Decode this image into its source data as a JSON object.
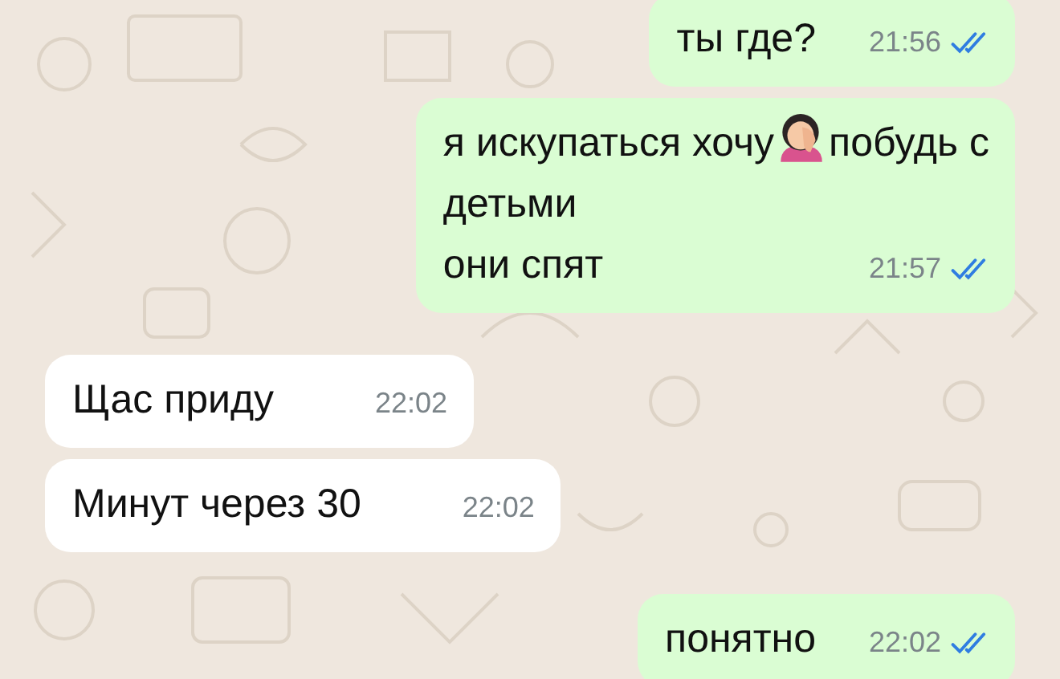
{
  "messages": [
    {
      "kind": "sent",
      "lines": [
        [
          {
            "kind": "text",
            "text": "ты где?"
          }
        ]
      ],
      "time": "21:56",
      "read": true
    },
    {
      "kind": "sent",
      "lines": [
        [
          {
            "kind": "text",
            "text": "я искупаться хочу"
          },
          {
            "kind": "emoji"
          },
          {
            "kind": "text",
            "text": "побудь с"
          }
        ],
        [
          {
            "kind": "text",
            "text": "детьми"
          }
        ],
        [
          {
            "kind": "text",
            "text": "они спят"
          }
        ]
      ],
      "time": "21:57",
      "read": true
    },
    {
      "kind": "received",
      "lines": [
        [
          {
            "kind": "text",
            "text": "Щас приду"
          }
        ]
      ],
      "time": "22:02"
    },
    {
      "kind": "received",
      "lines": [
        [
          {
            "kind": "text",
            "text": "Минут через 30"
          }
        ]
      ],
      "time": "22:02"
    },
    {
      "kind": "sent",
      "lines": [
        [
          {
            "kind": "text",
            "text": "понятно"
          }
        ]
      ],
      "time": "22:02",
      "read": true
    }
  ]
}
